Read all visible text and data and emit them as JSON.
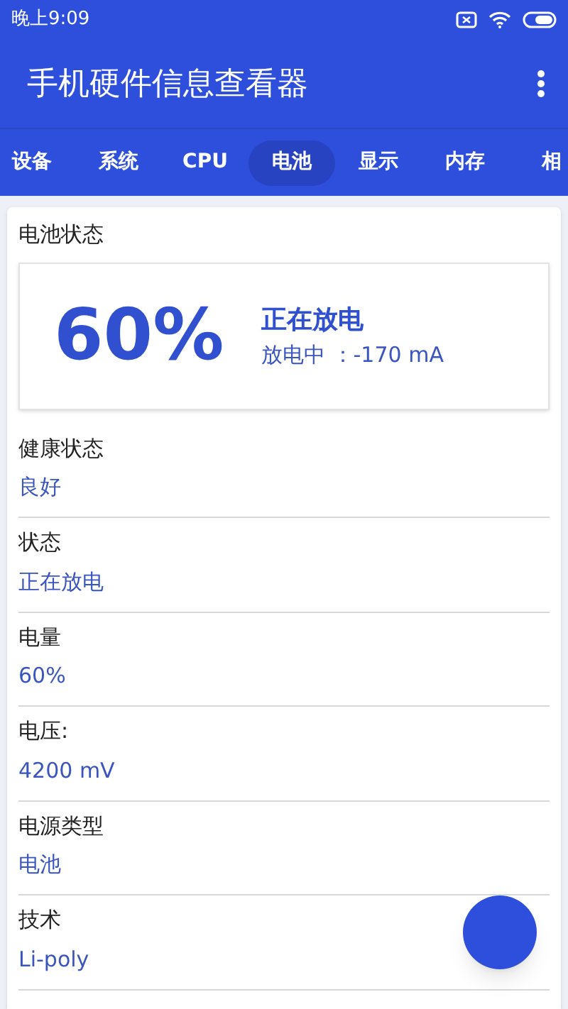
{
  "status_bar": {
    "time": "晚上9:09"
  },
  "app_bar": {
    "title": "手机硬件信息查看器"
  },
  "tabs": [
    {
      "label": "设备",
      "selected": false
    },
    {
      "label": "系统",
      "selected": false
    },
    {
      "label": "CPU",
      "selected": false
    },
    {
      "label": "电池",
      "selected": true
    },
    {
      "label": "显示",
      "selected": false
    },
    {
      "label": "内存",
      "selected": false
    },
    {
      "label": "相",
      "selected": false
    }
  ],
  "section": {
    "title": "电池状态",
    "summary": {
      "percent": "60%",
      "status": "正在放电",
      "current": "放电中 ：-170 mA"
    }
  },
  "rows": [
    {
      "label": "健康状态",
      "value": "良好"
    },
    {
      "label": "状态",
      "value": "正在放电"
    },
    {
      "label": "电量",
      "value": "60%"
    },
    {
      "label": "电压:",
      "value": "4200 mV"
    },
    {
      "label": "电源类型",
      "value": "电池"
    },
    {
      "label": "技术",
      "value": "Li-poly"
    }
  ]
}
